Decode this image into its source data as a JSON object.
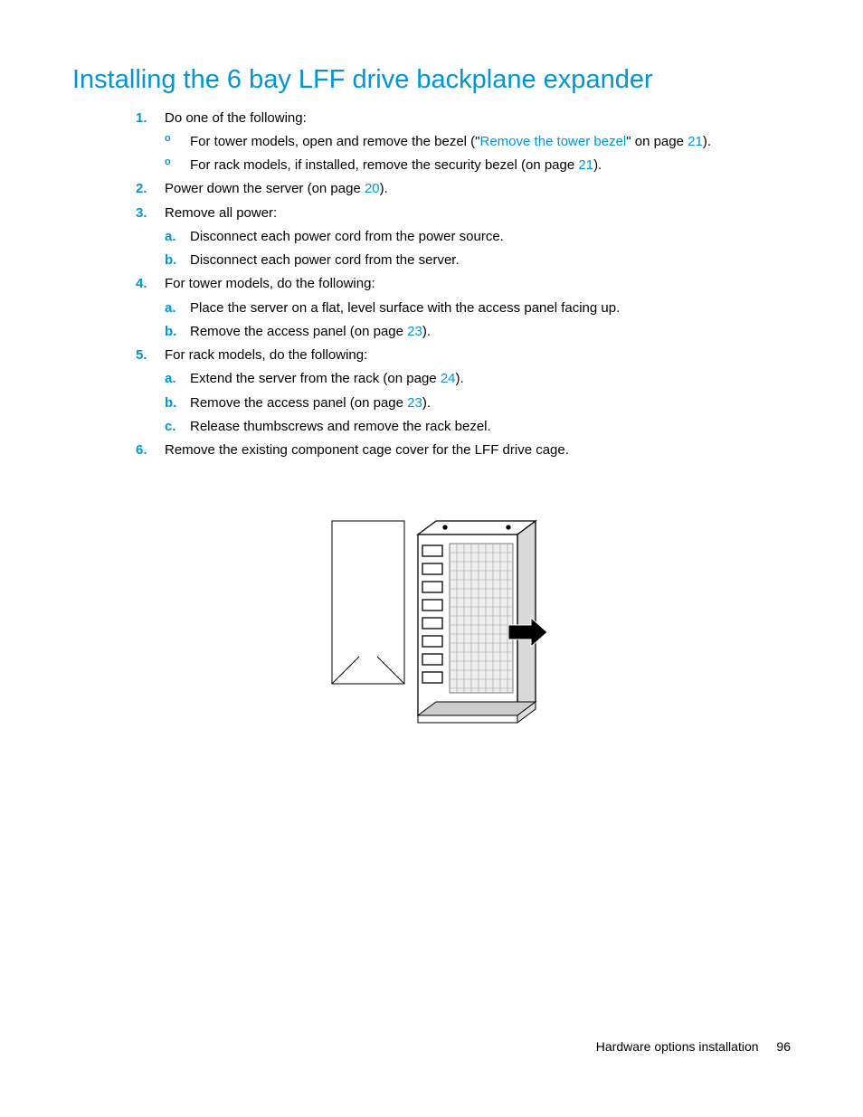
{
  "title": "Installing the 6 bay LFF drive backplane expander",
  "steps": {
    "s1": {
      "num": "1.",
      "text": "Do one of the following:",
      "b1_pre": "For tower models, open and remove the bezel (\"",
      "b1_link": "Remove the tower bezel",
      "b1_mid": "\" on page ",
      "b1_page": "21",
      "b1_post": ").",
      "b2_pre": "For rack models, if installed, remove the security bezel (on page ",
      "b2_page": "21",
      "b2_post": ")."
    },
    "s2": {
      "num": "2.",
      "pre": "Power down the server (on page ",
      "page": "20",
      "post": ")."
    },
    "s3": {
      "num": "3.",
      "text": "Remove all power:",
      "a_num": "a.",
      "a_text": "Disconnect each power cord from the power source.",
      "b_num": "b.",
      "b_text": "Disconnect each power cord from the server."
    },
    "s4": {
      "num": "4.",
      "text": "For tower models, do the following:",
      "a_num": "a.",
      "a_text": "Place the server on a flat, level surface with the access panel facing up.",
      "b_num": "b.",
      "b_pre": "Remove the access panel (on page ",
      "b_page": "23",
      "b_post": ")."
    },
    "s5": {
      "num": "5.",
      "text": "For rack models, do the following:",
      "a_num": "a.",
      "a_pre": "Extend the server from the rack (on page ",
      "a_page": "24",
      "a_post": ").",
      "b_num": "b.",
      "b_pre": "Remove the access panel (on page ",
      "b_page": "23",
      "b_post": ").",
      "c_num": "c.",
      "c_text": "Release thumbscrews and remove the rack bezel."
    },
    "s6": {
      "num": "6.",
      "text": "Remove the existing component cage cover for the LFF drive cage."
    }
  },
  "footer": {
    "section": "Hardware options installation",
    "page": "96"
  }
}
